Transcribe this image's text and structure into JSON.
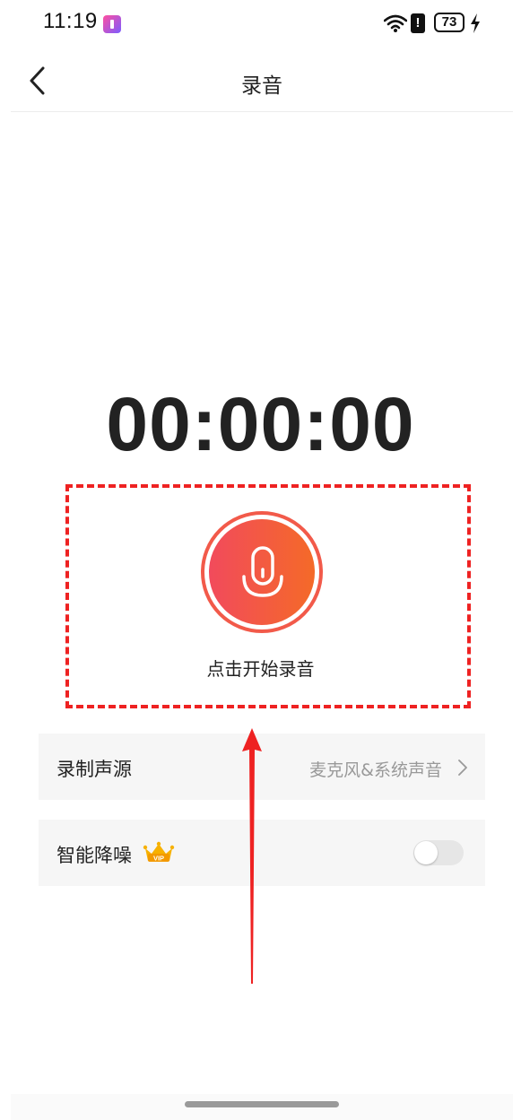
{
  "status_bar": {
    "time": "11:19",
    "alert_glyph": "!",
    "battery_level": "73"
  },
  "header": {
    "title": "录音",
    "back_icon": "chevron-left-icon"
  },
  "timer": {
    "display": "00:00:00"
  },
  "recorder": {
    "hint": "点击开始录音",
    "button_icon": "microphone-icon",
    "gradient_start": "#f24a5c",
    "gradient_end": "#f46a28"
  },
  "settings": {
    "source": {
      "label": "录制声源",
      "value": "麦克风&系统声音"
    },
    "noise_reduction": {
      "label": "智能降噪",
      "badge_text": "VIP",
      "enabled": false
    }
  },
  "colors": {
    "annotation_red": "#ee2222",
    "vip_gold": "#f7b100"
  }
}
